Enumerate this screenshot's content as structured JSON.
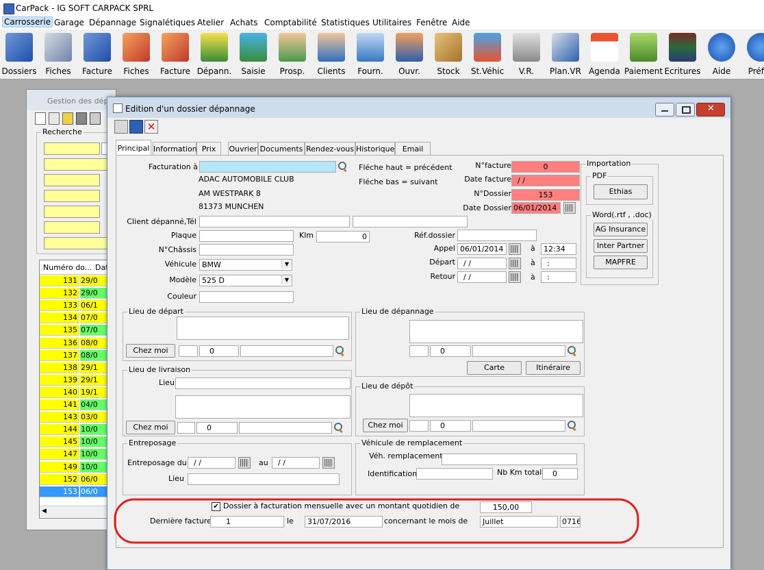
{
  "app": {
    "title": "CarPack - IG SOFT CARPACK SPRL"
  },
  "menu": [
    "Carrosserie",
    "Garage",
    "Dépannage",
    "Signalétiques",
    "Atelier",
    "Achats",
    "Comptabilité",
    "Statistiques",
    "Utilitaires",
    "Fenêtre",
    "Aide"
  ],
  "toolbar": [
    "Dossiers",
    "Fiches",
    "Facture",
    "Fiches",
    "Facture",
    "Dépann.",
    "Saisie",
    "Prosp.",
    "Clients",
    "Fourn.",
    "Ouvr.",
    "Stock",
    "St.Véhic",
    "V.R.",
    "Plan.VR",
    "Agenda",
    "Paiement",
    "Ecritures",
    "Aide",
    "Préf"
  ],
  "bg_window": {
    "title": "Gestion des dépa",
    "search_label": "Recherche",
    "grid_header": [
      "Numéro do...",
      "Dat"
    ],
    "rows": [
      {
        "num": "131",
        "date": "29/0"
      },
      {
        "num": "132",
        "date": "29/0"
      },
      {
        "num": "133",
        "date": "06/1"
      },
      {
        "num": "134",
        "date": "07/0"
      },
      {
        "num": "135",
        "date": "07/0"
      },
      {
        "num": "136",
        "date": "08/0"
      },
      {
        "num": "137",
        "date": "08/0"
      },
      {
        "num": "138",
        "date": "29/1"
      },
      {
        "num": "139",
        "date": "29/1"
      },
      {
        "num": "140",
        "date": "19/1"
      },
      {
        "num": "141",
        "date": "04/0"
      },
      {
        "num": "143",
        "date": "03/0"
      },
      {
        "num": "144",
        "date": "10/0"
      },
      {
        "num": "145",
        "date": "10/0"
      },
      {
        "num": "147",
        "date": "10/0"
      },
      {
        "num": "149",
        "date": "10/0"
      },
      {
        "num": "152",
        "date": "06/0"
      },
      {
        "num": "153",
        "date": "06/0"
      }
    ]
  },
  "dialog": {
    "title": "Edition d'un dossier dépannage",
    "tabs": [
      "Principal",
      "Informations",
      "Prix",
      "Ouvrier",
      "Documents",
      "Rendez-vous",
      "Historique",
      "Email"
    ],
    "facturation_label": "Facturation à",
    "address": [
      "ADAC AUTOMOBILE CLUB",
      "AM WESTPARK 8",
      "81373 MUNCHEN"
    ],
    "hint_up": "Fléche haut = précédent",
    "hint_down": "Fléche bas = suivant",
    "nfacture_label": "N°facture",
    "nfacture": "0",
    "datefacture_label": "Date facture",
    "datefacture": " / /",
    "ndossier_label": "N°Dossier",
    "ndossier": "153",
    "datedossier_label": "Date Dossier",
    "datedossier": "06/01/2014",
    "client_label": "Client dépanné,Tél",
    "plaque_label": "Plaque",
    "klm_label": "Klm",
    "klm": "0",
    "chassis_label": "N°Châssis",
    "vehicule_label": "Véhicule",
    "vehicule": "BMW",
    "modele_label": "Modèle",
    "modele": "525 D",
    "couleur_label": "Couleur",
    "refdossier_label": "Réf.dossier",
    "appel_label": "Appel",
    "appel_date": "06/01/2014",
    "appel_time": "12:34",
    "depart_label": "Départ",
    "depart_date": " / /",
    "depart_time": " :",
    "retour_label": "Retour",
    "retour_date": " / /",
    "retour_time": " :",
    "a_label": "à",
    "import": {
      "title": "Importation",
      "pdf_title": "PDF",
      "ethias": "Ethias",
      "word_title": "Word(.rtf , .doc)",
      "ag": "AG Insurance",
      "inter": "Inter Partner",
      "mapfre": "MAPFRE"
    },
    "lieu_depart": {
      "title": "Lieu de départ",
      "chez_moi": "Chez moi",
      "zero": "0"
    },
    "lieu_depannage": {
      "title": "Lieu de dépannage",
      "zero": "0",
      "carte": "Carte",
      "itineraire": "Itinéraire"
    },
    "lieu_livraison": {
      "title": "Lieu de livraison",
      "lieu": "Lieu",
      "chez_moi": "Chez moi",
      "zero": "0"
    },
    "lieu_depot": {
      "title": "Lieu de dépôt",
      "chez_moi": "Chez moi",
      "zero": "0"
    },
    "entreposage": {
      "title": "Entreposage",
      "du_label": "Entreposage du",
      "du": " / /",
      "au_label": "au",
      "au": " / /",
      "lieu": "Lieu"
    },
    "remplacement": {
      "title": "Véhicule de remplacement",
      "veh": "Véh. remplacement",
      "ident": "Identification",
      "km_label": "Nb Km total",
      "km": "0"
    },
    "monthly": {
      "checkbox_label": "Dossier à facturation mensuelle avec un montant quotidien de",
      "amount": "150,00",
      "last_label": "Dernière facture",
      "last": "1",
      "le_label": "le",
      "le": "31/07/2016",
      "mois_label": "concernant le mois de",
      "mois": "Juillet",
      "code": "0716"
    }
  },
  "colors": {
    "red_field": "#ff7f7f",
    "cyan_field": "#b4e7f8",
    "yellow": "#ffff00",
    "green": "#66ff66",
    "selected_row": "#3399ff",
    "highlight_ellipse": "#e01f1f"
  }
}
